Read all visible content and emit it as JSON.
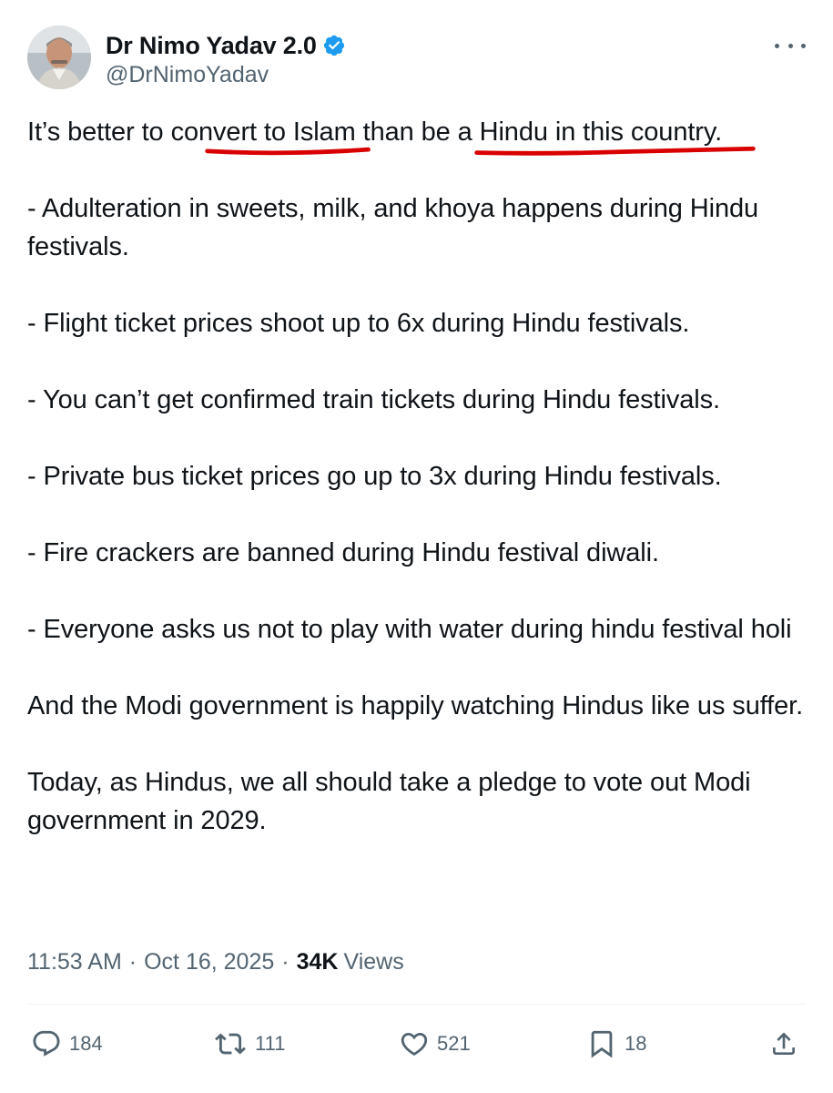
{
  "author": {
    "display_name": "Dr Nimo Yadav 2.0",
    "handle": "@DrNimoYadav",
    "verified": true,
    "avatar": "avatar-photo"
  },
  "tweet": {
    "line1_a": "It’s better to ",
    "line1_u1": "convert to Islam",
    "line1_b": " than ",
    "line1_u2": "be a Hindu in this country",
    "line1_c": ".",
    "p1": "- Adulteration in sweets, milk, and khoya happens during Hindu festivals.",
    "p2": "- Flight ticket prices shoot up to 6x during Hindu festivals.",
    "p3": "- You can’t get confirmed train tickets during Hindu festivals.",
    "p4": "- Private bus ticket prices go up to 3x during Hindu festivals.",
    "p5": "- Fire crackers are banned during Hindu festival diwali.",
    "p6": "- Everyone asks us not to play with water during hindu festival holi",
    "p7": "And the Modi government is happily watching Hindus like us suffer.",
    "p8": "Today, as Hindus, we all should take a pledge to vote out Modi government in 2029."
  },
  "meta": {
    "time": "11:53 AM",
    "date": "Oct 16, 2025",
    "separator": "·",
    "views_count": "34K",
    "views_label": "Views"
  },
  "actions": {
    "replies": "184",
    "reposts": "111",
    "likes": "521",
    "bookmarks": "18"
  },
  "colors": {
    "text": "#0f1419",
    "secondary": "#536471",
    "verified": "#1d9bf0",
    "annotation_red": "#d90000"
  }
}
